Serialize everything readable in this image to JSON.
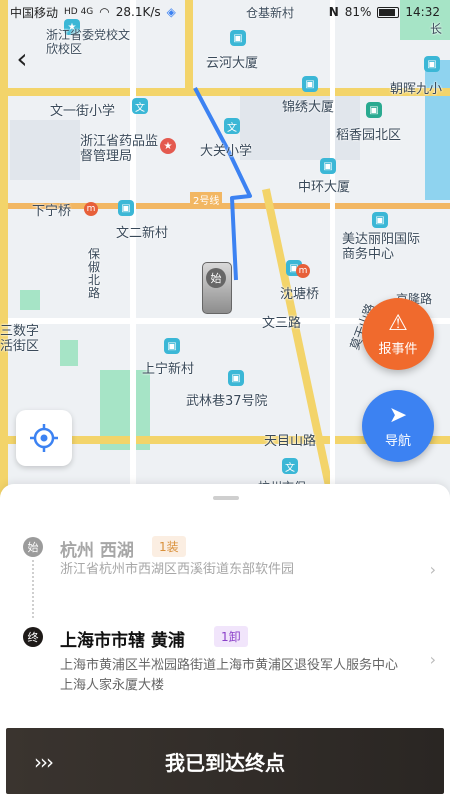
{
  "status_bar": {
    "carrier": "中国移动",
    "network": "HD 4G",
    "speed": "28.1K/s",
    "battery": "81%",
    "time": "14:32"
  },
  "map": {
    "labels": [
      "浙江省委党校文欣校区",
      "云河大厦",
      "仓基新村",
      "长",
      "朝晖九小",
      "文一街小学",
      "锦绣大厦",
      "稻香园北区",
      "浙江省药品监督管理局",
      "大关小学",
      "中环大厦",
      "下宁桥",
      "2号线",
      "文二新村",
      "美达丽阳国际商务中心",
      "保俶北路",
      "沈塘桥",
      "文三路",
      "三数字活街区",
      "上宁新村",
      "武林巷37号院",
      "天目山路",
      "杭州市保",
      "莫干山路",
      "京隆路"
    ],
    "car_label": "始"
  },
  "buttons": {
    "report": "报事件",
    "navigate": "导航",
    "arrive": "我已到达终点"
  },
  "start": {
    "pin": "始",
    "title": "杭州 西湖",
    "tag": "1装",
    "address": "浙江省杭州市西湖区西溪街道东部软件园"
  },
  "end": {
    "pin": "终",
    "title": "上海市市辖 黄浦",
    "tag": "1卸",
    "address": "上海市黄浦区半凇园路街道上海市黄浦区退役军人服务中心上海人家永厦大楼"
  }
}
